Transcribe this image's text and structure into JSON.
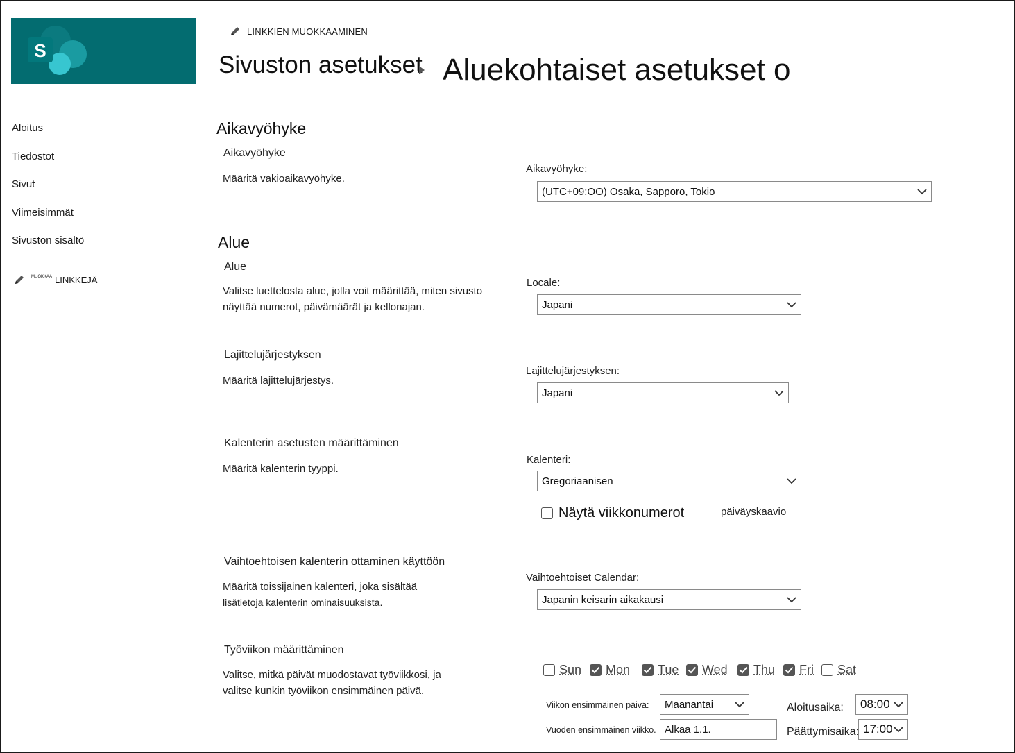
{
  "header": {
    "edit_links": "LINKKIEN MUOKKAAMINEN",
    "breadcrumb": "Sivuston asetukset",
    "title": "Aluekohtaiset asetukset o"
  },
  "nav": {
    "items": [
      "Aloitus",
      "Tiedostot",
      "Sivut",
      "Viimeisimmät",
      "Sivuston sisältö"
    ],
    "edit_small": "MUOKKAA",
    "edit_label": "LINKKEJÄ"
  },
  "timezone_section": {
    "heading": "Aikavyöhyke",
    "group_title": "Aikavyöhyke",
    "description": "Määritä vakioaikavyöhyke.",
    "field_label": "Aikavyöhyke:",
    "value": "(UTC+09:OO) Osaka, Sapporo, Tokio"
  },
  "region_section": {
    "heading": "Alue",
    "locale": {
      "group_title": "Alue",
      "description_line1": "Valitse luettelosta alue, jolla voit määrittää, miten sivusto",
      "description_line2": "näyttää numerot, päivämäärät ja kellonajan.",
      "field_label": "Locale:",
      "value": "Japani"
    },
    "sort": {
      "group_title": "Lajittelujärjestyksen",
      "description": "Määritä lajittelujärjestys.",
      "field_label": "Lajittelujärjestyksen:",
      "value": "Japani"
    },
    "calendar": {
      "group_title": "Kalenterin asetusten määrittäminen",
      "description": "Määritä kalenterin tyyppi.",
      "field_label": "Kalenteri:",
      "value": "Gregoriaanisen",
      "week_numbers_label": "Näytä viikkonumerot",
      "week_numbers_suffix": "päiväyskaavio",
      "week_numbers_checked": false
    },
    "alt_calendar": {
      "group_title": "Vaihtoehtoisen kalenterin ottaminen käyttöön",
      "description_line1": "Määritä toissijainen kalenteri, joka sisältää",
      "description_line2": "lisätietoja kalenterin ominaisuuksista.",
      "field_label": "Vaihtoehtoiset Calendar:",
      "value": "Japanin keisarin aikakausi"
    },
    "work_week": {
      "group_title": "Työviikon määrittäminen",
      "description_line1": "Valitse, mitkä päivät muodostavat työviikkosi, ja",
      "description_line2": "valitse kunkin työviikon ensimmäinen päivä.",
      "days": [
        {
          "label": "Sun",
          "checked": false
        },
        {
          "label": "Mon",
          "checked": true
        },
        {
          "label": "Tue",
          "checked": true
        },
        {
          "label": "Wed",
          "checked": true
        },
        {
          "label": "Thu",
          "checked": true
        },
        {
          "label": "Fri",
          "checked": true
        },
        {
          "label": "Sat",
          "checked": false
        }
      ],
      "first_day_label": "Viikon ensimmäinen päivä:",
      "first_day_value": "Maanantai",
      "first_week_label": "Vuoden ensimmäinen viikko.",
      "first_week_value": "Alkaa 1.1.",
      "start_time_label": "Aloitusaika:",
      "start_time_value": "08:00",
      "end_time_label": "Päättymisaika:",
      "end_time_value": "17:00"
    }
  },
  "colors": {
    "logo_bg": "#036c70",
    "logo_dark": "#1a9ba1",
    "logo_light": "#37c6d0"
  }
}
